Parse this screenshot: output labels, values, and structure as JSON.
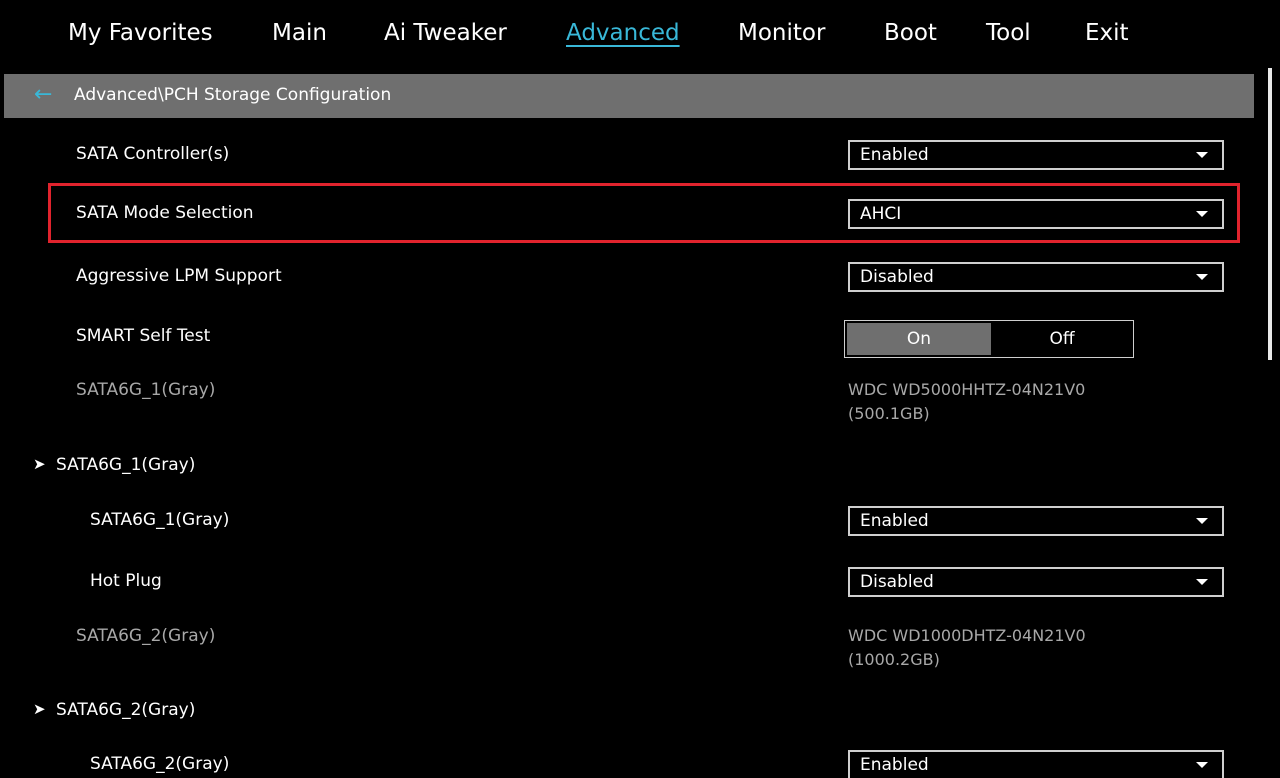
{
  "menu": {
    "items": [
      "My Favorites",
      "Main",
      "Ai Tweaker",
      "Advanced",
      "Monitor",
      "Boot",
      "Tool",
      "Exit"
    ],
    "active": "Advanced"
  },
  "breadcrumb": {
    "back_icon": "arrow-left-icon",
    "path": "Advanced\\PCH Storage Configuration"
  },
  "settings": {
    "sata_controllers": {
      "label": "SATA Controller(s)",
      "value": "Enabled"
    },
    "sata_mode": {
      "label": "SATA Mode Selection",
      "value": "AHCI"
    },
    "aggressive_lpm": {
      "label": "Aggressive LPM Support",
      "value": "Disabled"
    },
    "smart_self_test": {
      "label": "SMART Self Test",
      "on": "On",
      "off": "Off",
      "selected": "On"
    },
    "sata6g_1_info": {
      "label": "SATA6G_1(Gray)",
      "drive_line1": "WDC WD5000HHTZ-04N21V0",
      "drive_line2": "(500.1GB)"
    },
    "sata6g_1_group": {
      "label": "SATA6G_1(Gray)"
    },
    "sata6g_1_port": {
      "label": "SATA6G_1(Gray)",
      "value": "Enabled"
    },
    "sata6g_1_hotplug": {
      "label": "Hot Plug",
      "value": "Disabled"
    },
    "sata6g_2_info": {
      "label": "SATA6G_2(Gray)",
      "drive_line1": "WDC WD1000DHTZ-04N21V0",
      "drive_line2": "(1000.2GB)"
    },
    "sata6g_2_group": {
      "label": "SATA6G_2(Gray)"
    },
    "sata6g_2_port": {
      "label": "SATA6G_2(Gray)",
      "value": "Enabled"
    }
  },
  "colors": {
    "accent": "#39b8d8",
    "highlight": "#e0232d",
    "bar": "#6f6f6f"
  }
}
